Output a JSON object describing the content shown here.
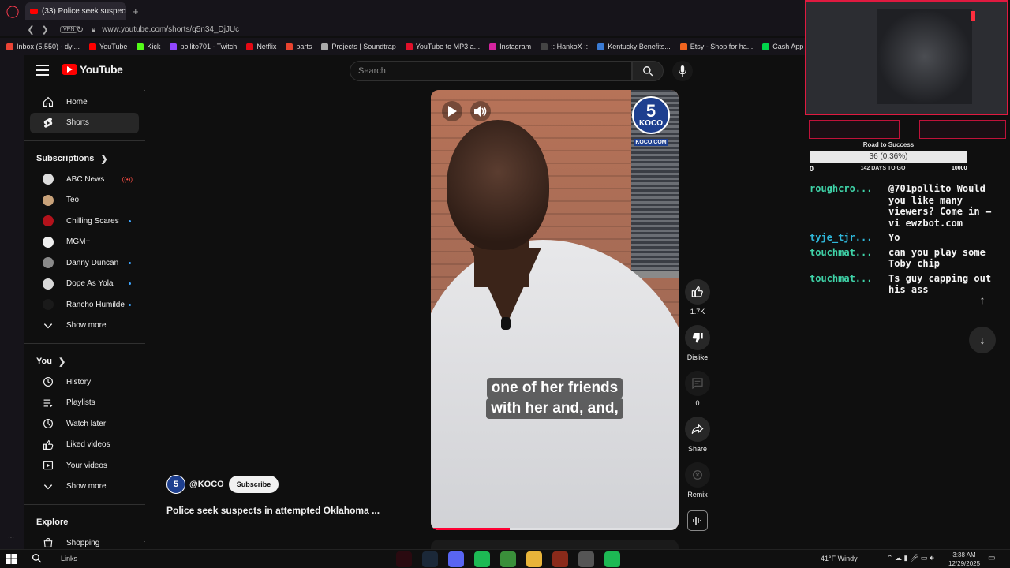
{
  "browser": {
    "tab_title": "(33) Police seek suspects",
    "new_tab": "+",
    "url": "www.youtube.com/shorts/q5n34_DjJUc",
    "vpn": "VPN",
    "bookmarks": [
      {
        "label": "Inbox (5,550) - dyl...",
        "color": "#ea4335"
      },
      {
        "label": "YouTube",
        "color": "#ff0000"
      },
      {
        "label": "Kick",
        "color": "#53fc18"
      },
      {
        "label": "pollito701 - Twitch",
        "color": "#9146ff"
      },
      {
        "label": "Netflix",
        "color": "#e50914"
      },
      {
        "label": "parts",
        "color": "#e8432f"
      },
      {
        "label": "Projects | Soundtrap",
        "color": "#aaaaaa"
      },
      {
        "label": "YouTube to MP3 a...",
        "color": "#e0102a"
      },
      {
        "label": "Instagram",
        "color": "#d6249f"
      },
      {
        "label": ":: HankoX ::",
        "color": "#444444"
      },
      {
        "label": "Kentucky Benefits...",
        "color": "#3a7bd5"
      },
      {
        "label": "Etsy - Shop for ha...",
        "color": "#f1641e"
      },
      {
        "label": "Cash App",
        "color": "#00d54b"
      }
    ]
  },
  "youtube": {
    "logo": "YouTube",
    "search_placeholder": "Search",
    "sidebar": {
      "main": [
        {
          "label": "Home",
          "icon": "home-icon"
        },
        {
          "label": "Shorts",
          "icon": "shorts-icon",
          "active": true
        }
      ],
      "subscriptions_header": "Subscriptions",
      "subscriptions": [
        {
          "label": "ABC News",
          "color": "#dddddd",
          "status": "live"
        },
        {
          "label": "Teo",
          "color": "#c9a27a",
          "status": ""
        },
        {
          "label": "Chilling Scares",
          "color": "#b3121b",
          "status": "dot"
        },
        {
          "label": "MGM+",
          "color": "#eeeeee",
          "status": ""
        },
        {
          "label": "Danny Duncan",
          "color": "#8a8a8a",
          "status": "dot"
        },
        {
          "label": "Dope As Yola",
          "color": "#d9d9d9",
          "status": "dot"
        },
        {
          "label": "Rancho Humilde",
          "color": "#1a1a1a",
          "status": "dot"
        }
      ],
      "show_more": "Show more",
      "you_header": "You",
      "you": [
        {
          "label": "History",
          "icon": "history-icon"
        },
        {
          "label": "Playlists",
          "icon": "playlists-icon"
        },
        {
          "label": "Watch later",
          "icon": "clock-icon"
        },
        {
          "label": "Liked videos",
          "icon": "thumbs-up-icon"
        },
        {
          "label": "Your videos",
          "icon": "video-icon"
        }
      ],
      "show_more_2": "Show more",
      "explore_header": "Explore",
      "explore": [
        {
          "label": "Shopping",
          "icon": "shopping-bag-icon"
        }
      ]
    },
    "short": {
      "caption_line1": "one of her friends",
      "caption_line2": "with her and, and,",
      "station_number": "5",
      "station_name": "KOCO",
      "station_url": "KOCO.COM",
      "progress": 0.32
    },
    "actions": {
      "like_count": "1.7K",
      "dislike_label": "Dislike",
      "comment_count": "0",
      "share_label": "Share",
      "remix_label": "Remix"
    },
    "channel": {
      "avatar_text": "5",
      "handle": "@KOCO",
      "subscribe_label": "Subscribe"
    },
    "title": "Police seek suspects in attempted Oklahoma ..."
  },
  "stream_overlay": {
    "goal_title": "Road to Success",
    "goal_value": "36 (0.36%)",
    "goal_progress": 0.0036,
    "goal_min": "0",
    "goal_days": "142 DAYS TO GO",
    "goal_max": "10000",
    "chat": [
      {
        "user": "roughcro...",
        "text": "@701pollito Would you like many viewers? Come in — vi ewzbot.com",
        "color": "green"
      },
      {
        "user": "tyje_tjr...",
        "text": "Yo",
        "color": "blue"
      },
      {
        "user": "touchmat...",
        "text": "can you play some Toby chip",
        "color": "green"
      },
      {
        "user": "touchmat...",
        "text": "Ts guy capping out his ass",
        "color": "green"
      }
    ]
  },
  "taskbar": {
    "links_label": "Links",
    "weather": "41°F  Windy",
    "time": "3:38 AM",
    "date": "12/29/2025",
    "apps": [
      {
        "name": "opera-gx-icon",
        "color": "#2a0a10"
      },
      {
        "name": "steam-icon",
        "color": "#1b2838"
      },
      {
        "name": "discord-icon",
        "color": "#5865f2"
      },
      {
        "name": "chat-app-icon",
        "color": "#1db954"
      },
      {
        "name": "globe-icon",
        "color": "#3a8f3a"
      },
      {
        "name": "folder-icon",
        "color": "#e8b43a"
      },
      {
        "name": "game-icon",
        "color": "#8a2a1a"
      },
      {
        "name": "settings-icon",
        "color": "#555555"
      },
      {
        "name": "spotify-icon",
        "color": "#1db954"
      }
    ]
  }
}
